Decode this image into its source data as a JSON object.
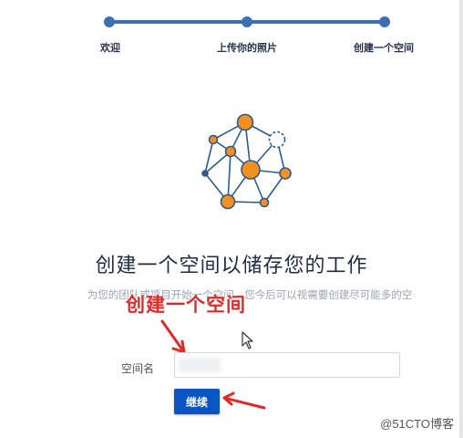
{
  "stepper": {
    "steps": [
      {
        "label": "欢迎"
      },
      {
        "label": "上传你的照片"
      },
      {
        "label": "创建一个空间"
      }
    ]
  },
  "illustration": {
    "icon": "network-graph-icon",
    "colors": {
      "node": "#f39020",
      "edge": "#2e5b8c",
      "node_outline": "#2e5b8c"
    }
  },
  "main": {
    "headline": "创建一个空间以储存您的工作",
    "subtext": "为您的团队或项目开始一个空间。您今后可以视需要创建尽可能多的空"
  },
  "annotation": {
    "text": "创建一个空间",
    "color": "#e02a2a"
  },
  "form": {
    "space_name_label": "空间名",
    "space_name_value": "",
    "continue_label": "继续"
  },
  "watermark": "@51CTO博客",
  "colors": {
    "accent": "#3f6fb3",
    "button": "#0a54c4"
  }
}
